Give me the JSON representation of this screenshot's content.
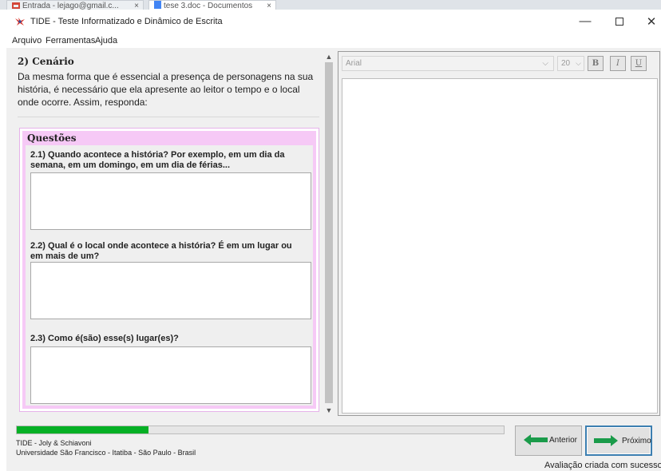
{
  "browser": {
    "tabs": [
      {
        "label": "Entrada - lejago@gmail.c...",
        "close": "×"
      },
      {
        "label": "tese 3.doc - Documentos",
        "close": "×"
      }
    ]
  },
  "window": {
    "title": "TIDE - Teste Informatizado e Dinâmico de Escrita",
    "controls": {
      "minimize": "—",
      "close": "✕"
    }
  },
  "menu": [
    "Arquivo",
    "Ferramentas",
    "Ajuda"
  ],
  "section": {
    "title": "2) Cenário",
    "intro": "Da mesma forma que é essencial a presença de personagens na sua história, é necessário que ela apresente ao leitor o tempo e o local onde ocorre. Assim, responda:"
  },
  "questions": {
    "title": "Questões",
    "items": [
      {
        "label": "2.1) Quando acontece a história? Por exemplo, em um dia da semana, em um domingo, em um dia de férias...",
        "answer": ""
      },
      {
        "label": "2.2) Qual é o local onde acontece a história? É em um lugar ou em mais de um?",
        "answer": ""
      },
      {
        "label": "2.3) Como é(são) esse(s) lugar(es)?",
        "answer": ""
      }
    ]
  },
  "editor": {
    "font": "Arial",
    "size": "20",
    "bold_label": "B",
    "italic_label": "I",
    "underline_label": "U",
    "content": ""
  },
  "progress": {
    "fraction": 0.27,
    "fill_color": "#06b025"
  },
  "footer": {
    "credits": "TIDE - Joly & Schiavoni",
    "institution": "Universidade São Francisco - Itatiba - São Paulo - Brasil"
  },
  "nav": {
    "previous": "Anterior",
    "next": "Próximo",
    "arrow_color": "#1a9b4a"
  },
  "status": "Avaliação criada com sucesso!"
}
